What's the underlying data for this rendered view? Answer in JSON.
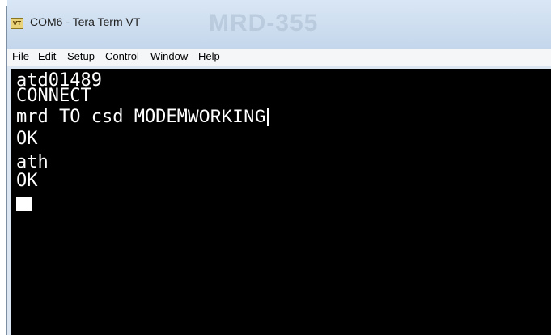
{
  "window": {
    "title": "COM6 - Tera Term VT",
    "icon": "vt-terminal-icon",
    "background_watermark": "MRD-355"
  },
  "menu": {
    "items": [
      {
        "label": "File"
      },
      {
        "label": "Edit"
      },
      {
        "label": "Setup"
      },
      {
        "label": "Control"
      },
      {
        "label": "Window"
      },
      {
        "label": "Help"
      }
    ]
  },
  "terminal": {
    "background_color": "#000000",
    "text_color": "#ffffff",
    "lines": [
      {
        "text": "atd01489"
      },
      {
        "text": "CONNECT"
      },
      {
        "text": "mrd TO csd MODEM",
        "text_alt": "WORKING"
      },
      {
        "text": "OK"
      },
      {
        "text": "ath"
      },
      {
        "text": "OK"
      }
    ]
  }
}
